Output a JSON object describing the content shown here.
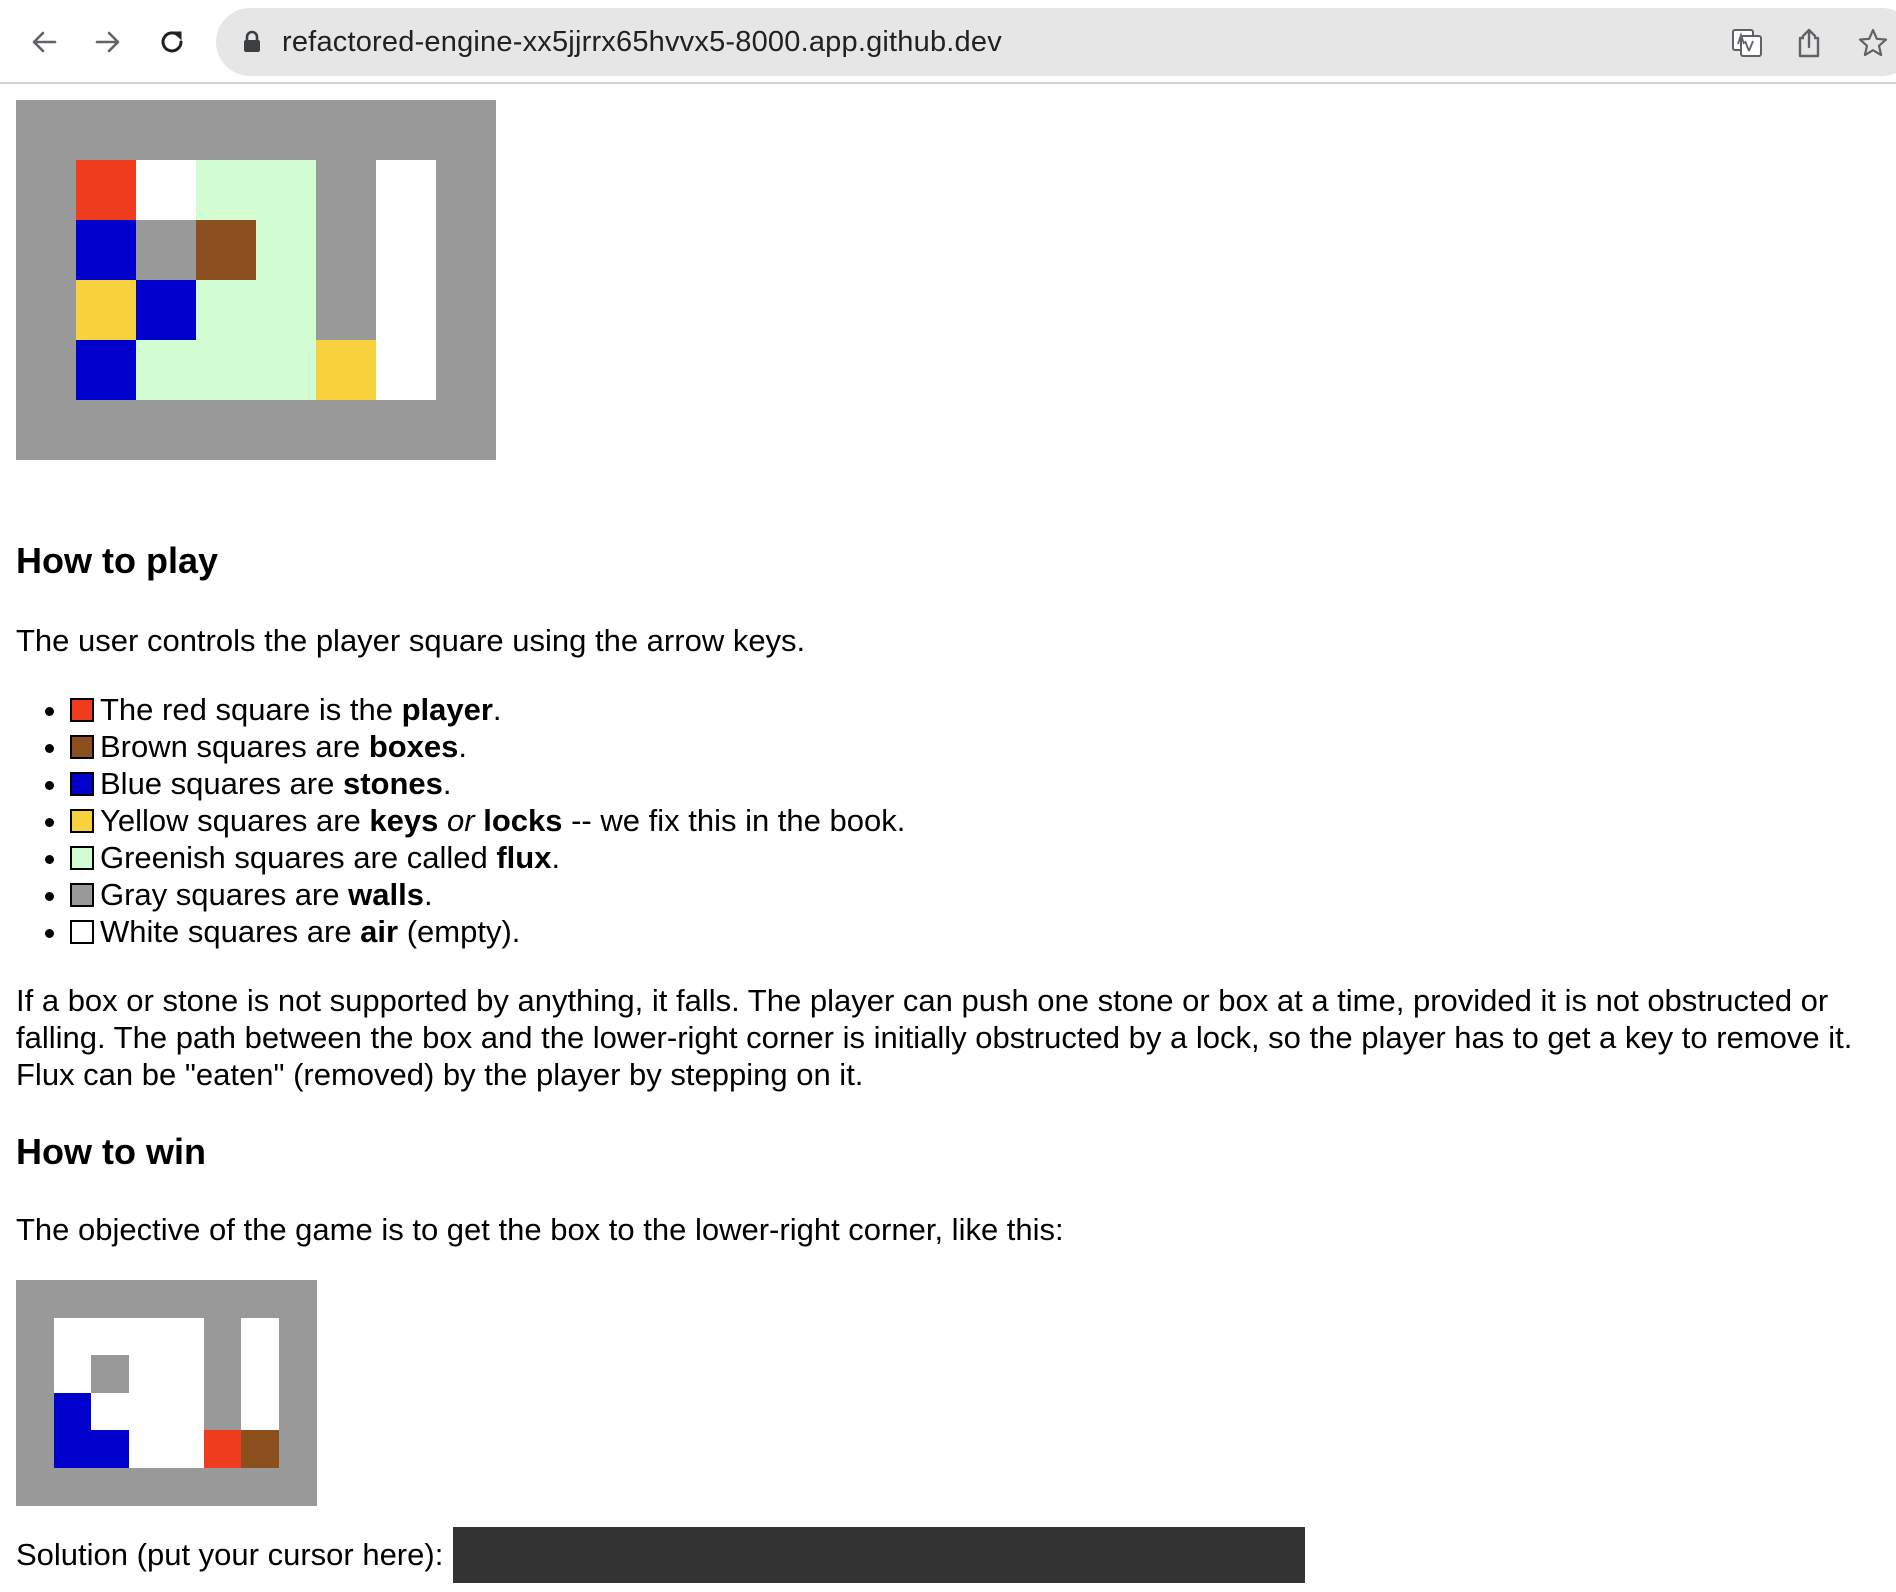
{
  "browser": {
    "url": "refactored-engine-xx5jjrrx65hvvx5-8000.app.github.dev",
    "icons": [
      "back-arrow-icon",
      "forward-arrow-icon",
      "reload-icon",
      "lock-icon",
      "translate-icon",
      "share-icon",
      "star-icon"
    ]
  },
  "colors": {
    "wall": "#999999",
    "player": "#f03c1e",
    "air": "#ffffff",
    "flux": "#d2fcd2",
    "box": "#8c501e",
    "stone": "#0000cc",
    "key_lock": "#f8d23c",
    "solution_bg": "#333333"
  },
  "game_board": {
    "cols": 8,
    "rows": 6,
    "grid": [
      "wall",
      "wall",
      "wall",
      "wall",
      "wall",
      "wall",
      "wall",
      "wall",
      "wall",
      "player",
      "air",
      "flux",
      "flux",
      "wall",
      "air",
      "wall",
      "wall",
      "stone",
      "wall",
      "box",
      "flux",
      "wall",
      "air",
      "wall",
      "wall",
      "key_lock",
      "stone",
      "flux",
      "flux",
      "wall",
      "air",
      "wall",
      "wall",
      "stone",
      "flux",
      "flux",
      "flux",
      "key_lock",
      "air",
      "wall",
      "wall",
      "wall",
      "wall",
      "wall",
      "wall",
      "wall",
      "wall",
      "wall"
    ]
  },
  "how_to_play": {
    "heading": "How to play",
    "intro": "The user controls the player square using the arrow keys.",
    "items": [
      {
        "color_key": "player",
        "before": "The red square is the ",
        "term": "player",
        "after": "."
      },
      {
        "color_key": "box",
        "before": "Brown squares are ",
        "term": "boxes",
        "after": "."
      },
      {
        "color_key": "stone",
        "before": "Blue squares are ",
        "term": "stones",
        "after": "."
      },
      {
        "color_key": "key_lock",
        "before": "Yellow squares are ",
        "term": "keys",
        "middle": "or",
        "term2": "locks",
        "after": " -- we fix this in the book."
      },
      {
        "color_key": "flux",
        "before": "Greenish squares are called ",
        "term": "flux",
        "after": "."
      },
      {
        "color_key": "wall",
        "before": "Gray squares are ",
        "term": "walls",
        "after": "."
      },
      {
        "color_key": "air",
        "before": "White squares are ",
        "term": "air",
        "after": " (empty)."
      }
    ],
    "rules_paragraph": "If a box or stone is not supported by anything, it falls. The player can push one stone or box at a time, provided it is not obstructed or falling. The path between the box and the lower-right corner is initially obstructed by a lock, so the player has to get a key to remove it. Flux can be \"eaten\" (removed) by the player by stepping on it."
  },
  "how_to_win": {
    "heading": "How to win",
    "objective": "The objective of the game is to get the box to the lower-right corner, like this:"
  },
  "win_board": {
    "cols": 8,
    "rows": 6,
    "grid": [
      "wall",
      "wall",
      "wall",
      "wall",
      "wall",
      "wall",
      "wall",
      "wall",
      "wall",
      "air",
      "air",
      "air",
      "air",
      "wall",
      "air",
      "wall",
      "wall",
      "air",
      "wall",
      "air",
      "air",
      "wall",
      "air",
      "wall",
      "wall",
      "stone",
      "air",
      "air",
      "air",
      "wall",
      "air",
      "wall",
      "wall",
      "stone",
      "stone",
      "air",
      "air",
      "player",
      "box",
      "wall",
      "wall",
      "wall",
      "wall",
      "wall",
      "wall",
      "wall",
      "wall",
      "wall"
    ]
  },
  "solution": {
    "label": "Solution (put your cursor here):"
  }
}
